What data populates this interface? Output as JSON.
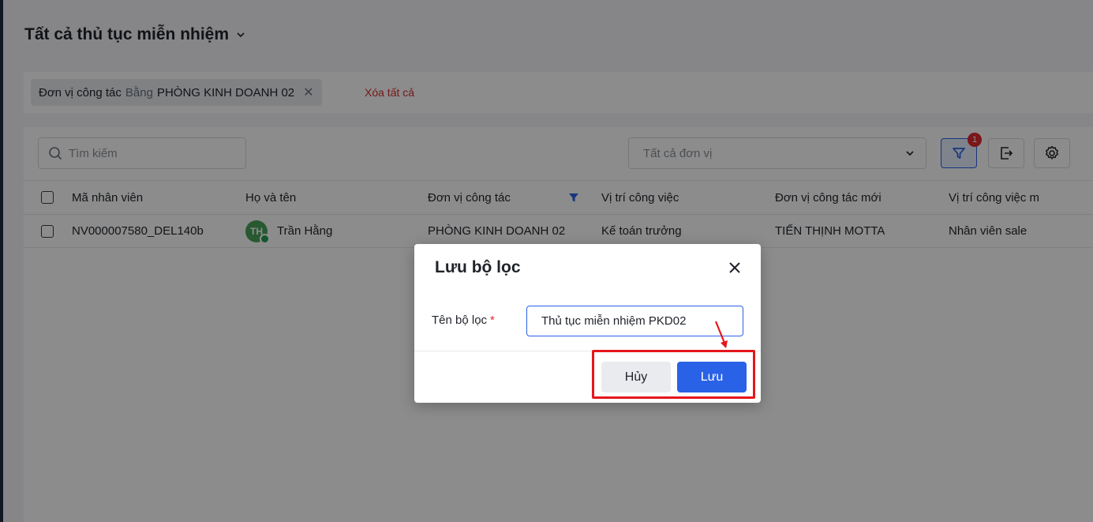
{
  "page": {
    "title": "Tất cả thủ tục miễn nhiệm"
  },
  "filter_bar": {
    "chip_field": "Đơn vị công tác",
    "chip_operator": "Bằng",
    "chip_value": "PHÒNG KINH DOANH 02",
    "clear_all": "Xóa tất cả"
  },
  "toolbar": {
    "search_placeholder": "Tìm kiếm",
    "unit_select_value": "Tất cả đơn vị",
    "filter_badge": "1"
  },
  "table": {
    "headers": [
      "Mã nhân viên",
      "Họ và tên",
      "Đơn vị công tác",
      "Vị trí công việc",
      "Đơn vị công tác mới",
      "Vị trí công việc m"
    ],
    "rows": [
      {
        "employee_id": "NV000007580_DEL140b",
        "avatar_initials": "TH",
        "full_name": "Trần Hằng",
        "unit": "PHÒNG KINH DOANH 02",
        "position": "Kế toán trưởng",
        "new_unit": "TIẾN THỊNH MOTTA",
        "new_position": "Nhân viên sale"
      }
    ]
  },
  "modal": {
    "title": "Lưu bộ lọc",
    "field_label": "Tên bộ lọc",
    "required_mark": "*",
    "field_value": "Thủ tục miễn nhiệm PKD02",
    "cancel_label": "Hủy",
    "save_label": "Lưu"
  },
  "colors": {
    "primary": "#2962e6",
    "danger": "#e0292f",
    "highlight": "#e5161b",
    "avatar": "#4aa35a"
  }
}
